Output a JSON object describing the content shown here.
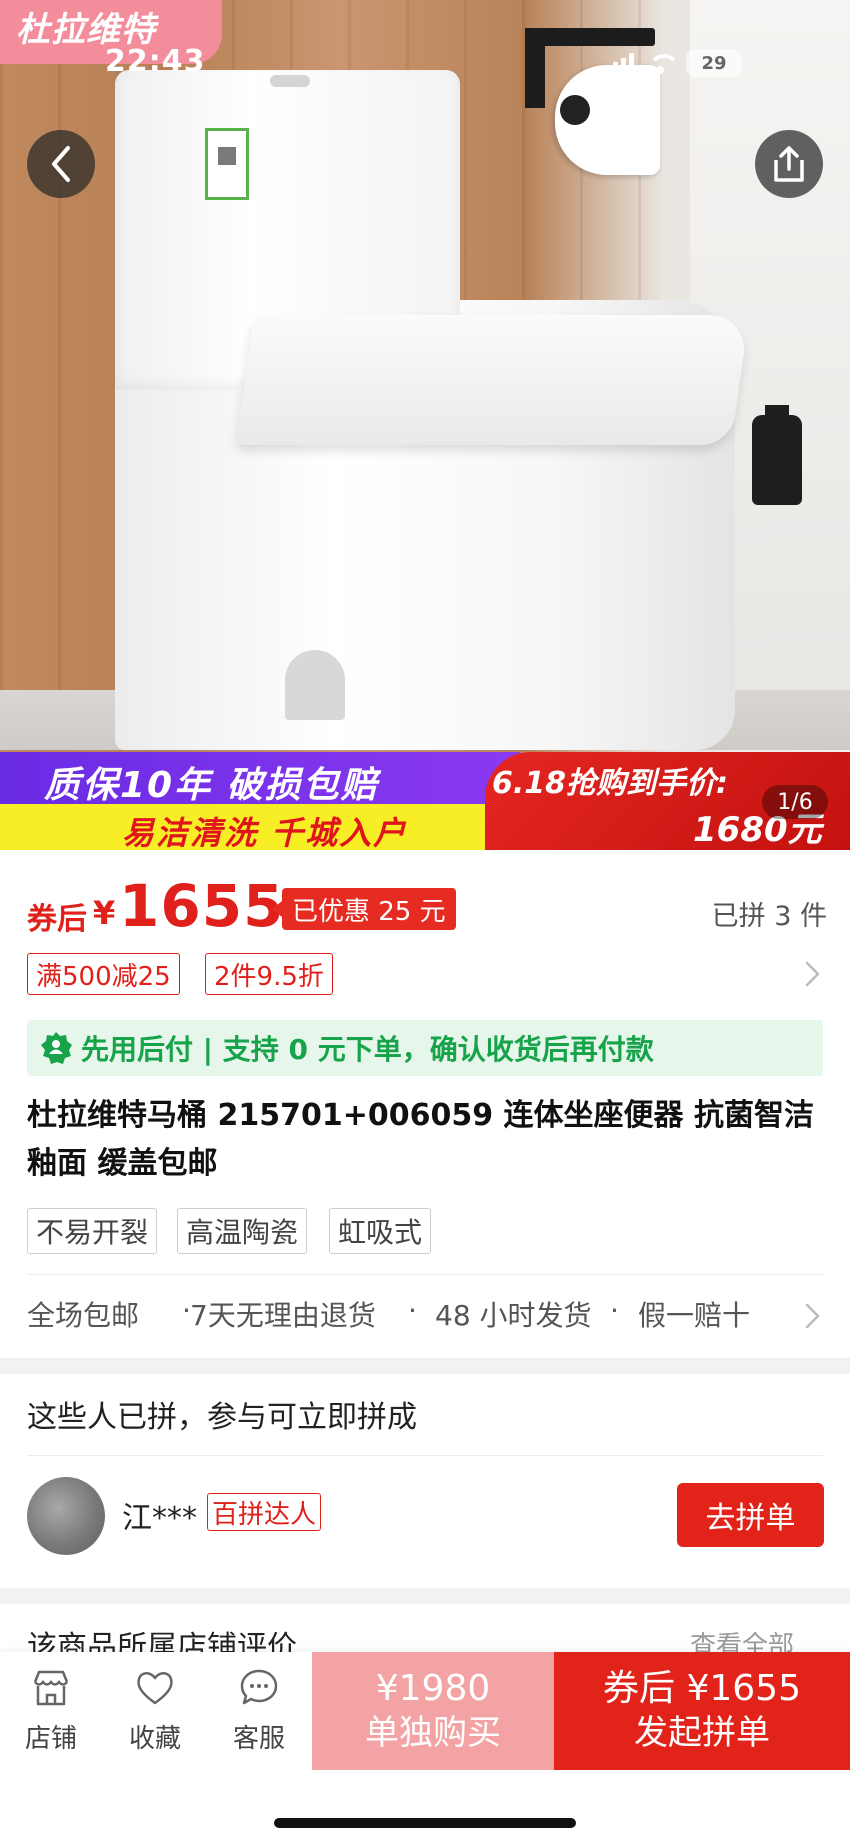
{
  "status_bar": {
    "time": "22:43",
    "battery": "29"
  },
  "hero": {
    "brand": "杜拉维特",
    "promo_line1": "质保10年  破损包赔",
    "promo_line2": "易洁清洗  千城入户",
    "promo_sale_label": "6.18抢购到手价:",
    "promo_sale_price": "1680元",
    "image_counter": "1/6"
  },
  "price": {
    "after_coupon_label": "券后",
    "currency": "¥",
    "amount": "1655",
    "saved_badge": "已优惠 25 元",
    "sold": "已拼 3 件"
  },
  "coupons": [
    "满500减25",
    "2件9.5折"
  ],
  "pay_later": {
    "icon": "user-badge-icon",
    "text": "先用后付 | 支持 0 元下单，确认收货后再付款"
  },
  "product": {
    "title": "杜拉维特马桶 215701+006059 连体坐座便器 抗菌智洁釉面 缓盖包邮",
    "features": [
      "不易开裂",
      "高温陶瓷",
      "虹吸式"
    ]
  },
  "services": [
    "全场包邮",
    "·",
    "7天无理由退货",
    "·",
    "48 小时发货",
    "·",
    "假一赔十"
  ],
  "group_buy": {
    "title": "这些人已拼，参与可立即拼成",
    "user_name": "江***",
    "user_badge": "百拼达人",
    "join_label": "去拼单"
  },
  "store_review": {
    "title": "该商品所属店铺评价",
    "view_all": "查看全部"
  },
  "bottom_bar": {
    "store": "店铺",
    "favorite": "收藏",
    "service": "客服",
    "solo_price": "¥1980",
    "solo_label": "单独购买",
    "group_price": "券后 ¥1655",
    "group_label": "发起拼单"
  },
  "colors": {
    "accent": "#e2231a",
    "pay_later_green": "#16a34a",
    "promo_purple": "#6a2be4",
    "promo_yellow": "#f8ee26"
  }
}
